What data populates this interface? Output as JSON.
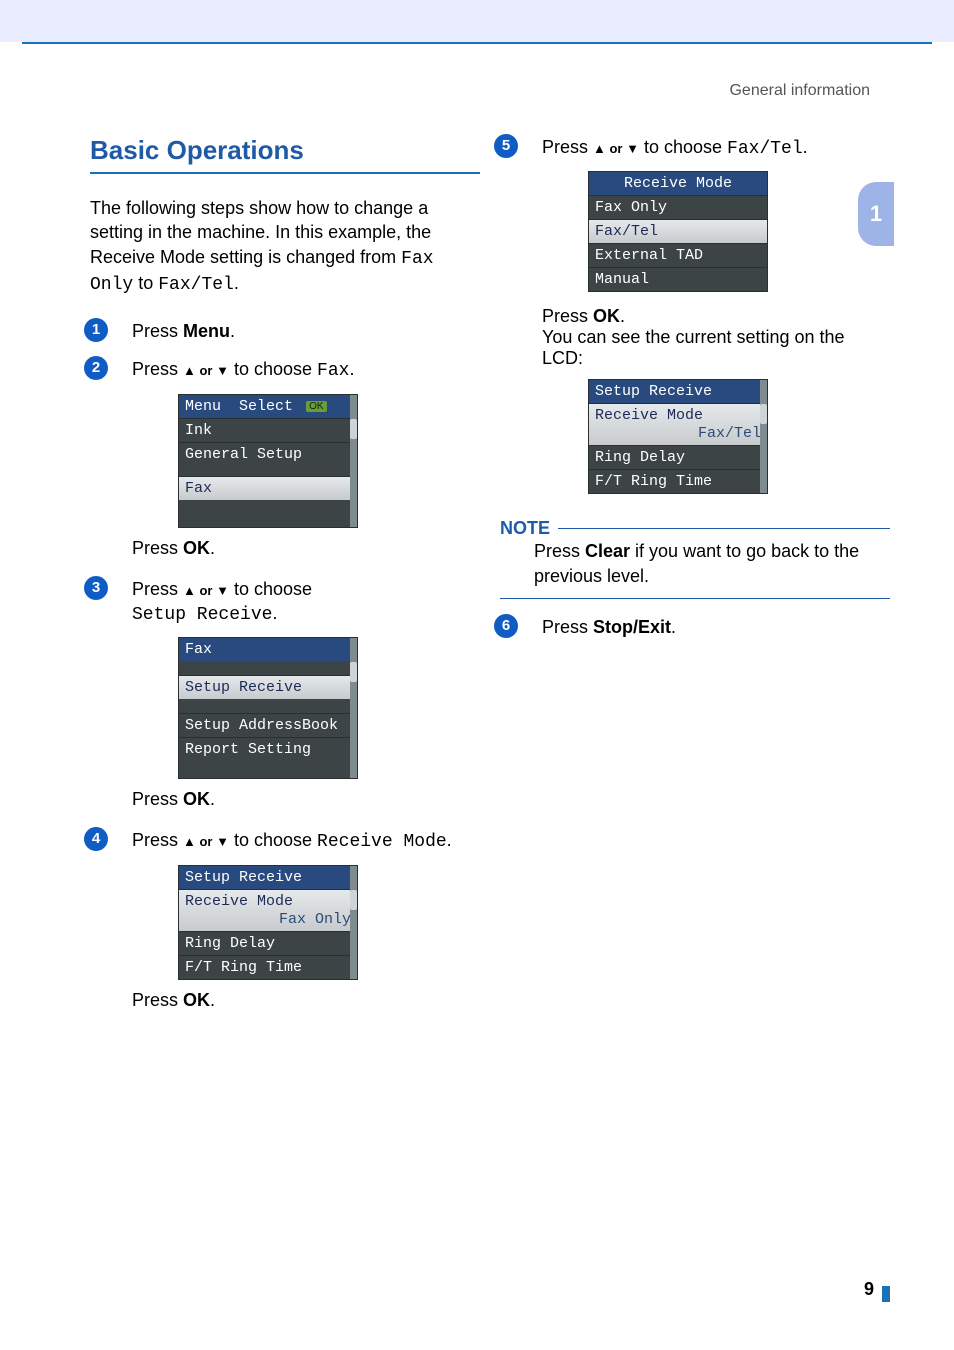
{
  "running_head": "General information",
  "chapter_tab": "1",
  "page_number": "9",
  "heading": "Basic Operations",
  "intro": {
    "t1": "The following steps show how to change a setting in the machine. In this example, the Receive Mode setting is changed from ",
    "m1": "Fax Only",
    "t2": " to ",
    "m2": "Fax/Tel",
    "t3": "."
  },
  "step1": {
    "n": "1",
    "a": "Press ",
    "b": "Menu",
    "c": "."
  },
  "step2": {
    "n": "2",
    "a": "Press ",
    "arrows": "▲ or ▼",
    "b": " to choose ",
    "m": "Fax",
    "c": "."
  },
  "ok": "OK",
  "press": "Press ",
  "period": ".",
  "lcd1": {
    "hdr_a": "Menu",
    "hdr_b": "Select",
    "hdr_ok": "OK",
    "r1": "Ink",
    "r2": "General Setup",
    "r3": "Fax"
  },
  "step3": {
    "n": "3",
    "a": "Press ",
    "arrows": "▲ or ▼",
    "b": " to choose ",
    "m": "Setup Receive",
    "c": "."
  },
  "lcd2": {
    "hdr": "Fax",
    "r1": "Setup Receive",
    "r2": "Setup AddressBook",
    "r3": "Report Setting"
  },
  "step4": {
    "n": "4",
    "a": "Press ",
    "arrows": "▲ or ▼",
    "b": " to choose ",
    "m": "Receive Mode",
    "c": "."
  },
  "lcd3": {
    "hdr": "Setup Receive",
    "r1": "Receive Mode",
    "r1v": "Fax Only",
    "r2": "Ring Delay",
    "r3": "F/T Ring Time"
  },
  "step5": {
    "n": "5",
    "a": "Press ",
    "arrows": "▲ or ▼",
    "b": " to choose ",
    "m": "Fax/Tel",
    "c": "."
  },
  "lcd4": {
    "hdr": "Receive Mode",
    "r1": "Fax Only",
    "r2": "Fax/Tel",
    "r3": "External TAD",
    "r4": "Manual"
  },
  "after5": {
    "a": "Press ",
    "ok": "OK",
    "b": ".",
    "c": "You can see the current setting on the LCD:"
  },
  "lcd5": {
    "hdr": "Setup Receive",
    "r1": "Receive Mode",
    "r1v": "Fax/Tel",
    "r2": "Ring Delay",
    "r3": "F/T Ring Time"
  },
  "note": {
    "head": "NOTE",
    "a": "Press ",
    "b": "Clear",
    "c": " if you want to go back to the previous level."
  },
  "step6": {
    "n": "6",
    "a": "Press ",
    "b": "Stop/Exit",
    "c": "."
  }
}
